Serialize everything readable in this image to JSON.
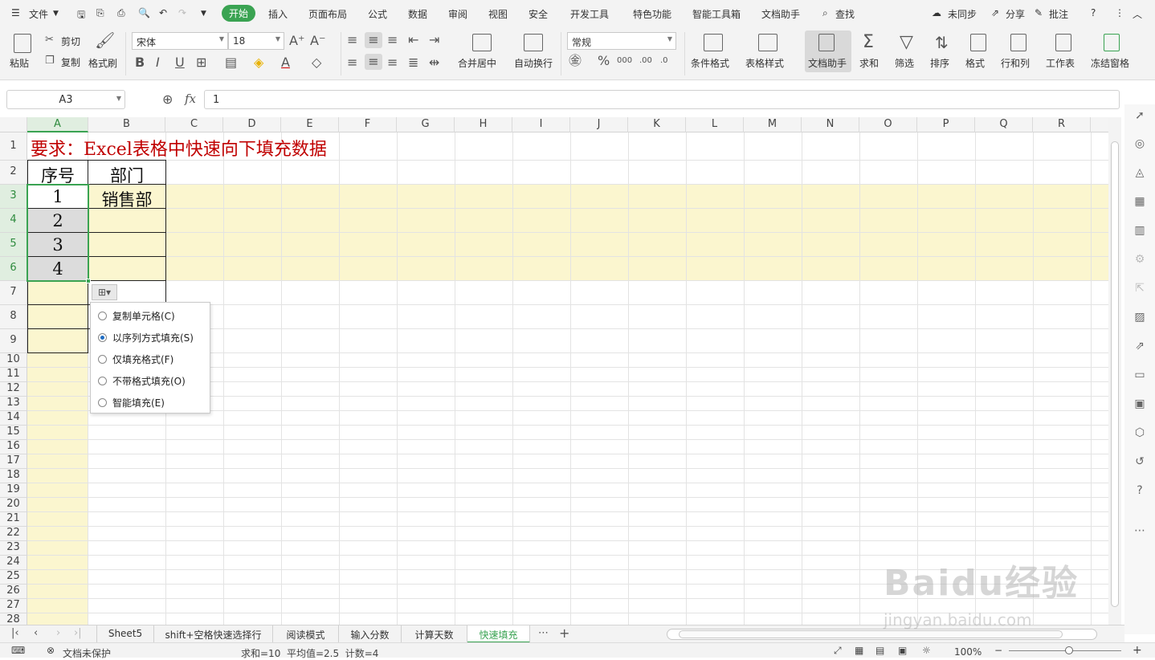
{
  "menubar": {
    "file": "文件",
    "tabs": [
      "开始",
      "插入",
      "页面布局",
      "公式",
      "数据",
      "审阅",
      "视图",
      "安全",
      "开发工具",
      "特色功能",
      "智能工具箱",
      "文档助手"
    ],
    "search": "查找",
    "sync": "未同步",
    "share": "分享",
    "annotate": "批注",
    "help": "?"
  },
  "ribbon": {
    "paste": "粘贴",
    "cut": "剪切",
    "copy": "复制",
    "format_painter": "格式刷",
    "font_name": "宋体",
    "font_size": "18",
    "number_format": "常规",
    "merge_center": "合并居中",
    "auto_wrap": "自动换行",
    "cond_format": "条件格式",
    "table_style": "表格样式",
    "doc_helper": "文档助手",
    "sum": "求和",
    "filter": "筛选",
    "sort": "排序",
    "format": "格式",
    "row_col": "行和列",
    "worksheet": "工作表",
    "freeze": "冻结窗格"
  },
  "formula": {
    "name_box": "A3",
    "fx": "fx",
    "value": "1"
  },
  "grid": {
    "columns": [
      "A",
      "B",
      "C",
      "D",
      "E",
      "F",
      "G",
      "H",
      "I",
      "J",
      "K",
      "L",
      "M",
      "N",
      "O",
      "P",
      "Q",
      "R"
    ],
    "rows": [
      "1",
      "2",
      "3",
      "4",
      "5",
      "6",
      "7",
      "8",
      "9",
      "10",
      "11",
      "12",
      "13",
      "14",
      "15",
      "16",
      "17",
      "18",
      "19",
      "20",
      "21",
      "22",
      "23",
      "24",
      "25",
      "26",
      "27",
      "28"
    ],
    "title": "要求：Excel表格中快速向下填充数据",
    "header_a": "序号",
    "header_b": "部门",
    "a3": "1",
    "a4": "2",
    "a5": "3",
    "a6": "4",
    "b3": "销售部",
    "title_color": "#c00000",
    "highlight_color": "#fbf6cf",
    "accent": "#3aa352"
  },
  "fill_popup": {
    "options": [
      "复制单元格(C)",
      "以序列方式填充(S)",
      "仅填充格式(F)",
      "不带格式填充(O)",
      "智能填充(E)"
    ],
    "selected_index": 1
  },
  "sheet_tabs": [
    "Sheet5",
    "shift+空格快速选择行",
    "阅读模式",
    "输入分数",
    "计算天数",
    "快速填充"
  ],
  "active_sheet": "快速填充",
  "status": {
    "protect": "文档未保护",
    "stats": "求和=10  平均值=2.5  计数=4",
    "zoom": "100%"
  },
  "watermark": {
    "brand": "Baidu经验",
    "url": "jingyan.baidu.com"
  }
}
